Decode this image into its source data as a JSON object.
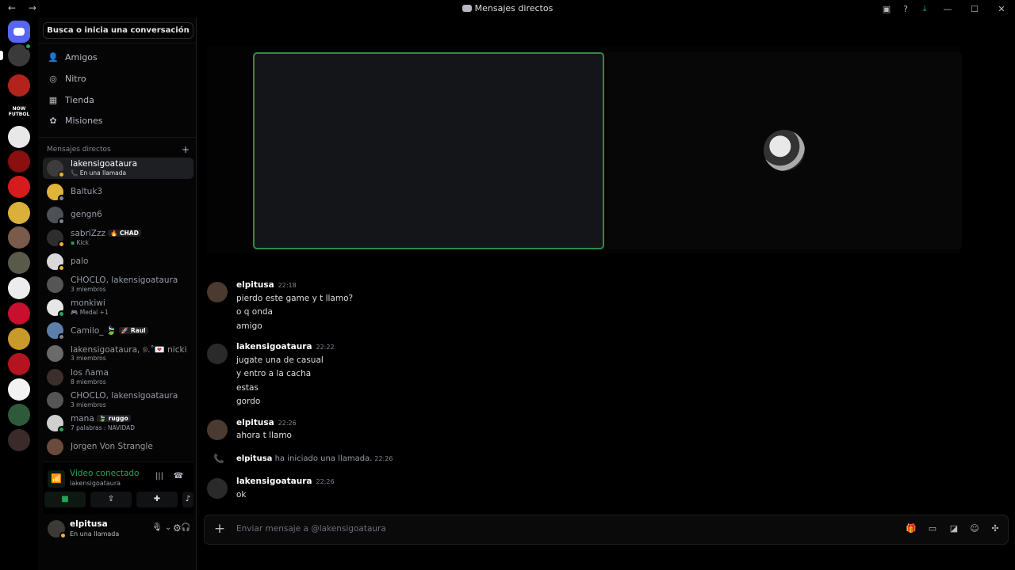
{
  "window": {
    "nav": "← →",
    "title": "Mensajes directos"
  },
  "servers": {
    "now_futbol_text": "NOW FUTBOL"
  },
  "sidebar": {
    "search_label": "Busca o inicia una conversación",
    "nav": [
      {
        "label": "Amigos",
        "icon": "friends-icon"
      },
      {
        "label": "Nitro",
        "icon": "nitro-icon"
      },
      {
        "label": "Tienda",
        "icon": "shop-icon"
      },
      {
        "label": "Misiones",
        "icon": "quests-icon"
      }
    ],
    "dm_header": "Mensajes directos",
    "dms": [
      {
        "name": "lakensigoataura",
        "sub": "En una llamada",
        "status": "idle"
      },
      {
        "name": "Baltuk3",
        "sub": "",
        "status": "offline"
      },
      {
        "name": "gengn6",
        "sub": "",
        "status": "offline"
      },
      {
        "name": "sabriZzz",
        "tag": "🔥 CHAD",
        "sub": "Kick",
        "status": "idle"
      },
      {
        "name": "palo",
        "sub": "",
        "status": "idle"
      },
      {
        "name": "CHOCLO, lakensigoataura",
        "sub": "3 miembros",
        "status": ""
      },
      {
        "name": "monkiwi",
        "sub": "Medal +1",
        "status": "online"
      },
      {
        "name": "Camilo_ 🍃",
        "tag": "🚀 Raul",
        "sub": "",
        "status": "offline"
      },
      {
        "name": "lakensigoataura, ୭.˚💌 nicki nic...",
        "sub": "3 miembros",
        "status": ""
      },
      {
        "name": "los ñama",
        "sub": "8 miembros",
        "status": ""
      },
      {
        "name": "CHOCLO, lakensigoataura",
        "sub": "3 miembros",
        "status": ""
      },
      {
        "name": "mana",
        "tag": "🍃 ruggo",
        "sub": "7 palabras : NAVIDAD",
        "status": "online"
      },
      {
        "name": "Jorgen Von Strangle",
        "sub": "",
        "status": ""
      }
    ]
  },
  "voice": {
    "title": "Video conectado",
    "channel": "lakensigoataura"
  },
  "user": {
    "name": "elpitusa",
    "status": "En una llamada"
  },
  "messages": [
    {
      "author": "elpitusa",
      "time": "22:18",
      "lines": [
        "pierdo este game y t llamo?",
        "o q onda",
        "amigo"
      ]
    },
    {
      "author": "lakensigoataura",
      "time": "22:22",
      "lines": [
        "jugate una de casual",
        "y entro a la cacha",
        "estas",
        "gordo"
      ]
    },
    {
      "author": "elpitusa",
      "time": "22:26",
      "lines": [
        "ahora t llamo"
      ]
    },
    {
      "author": "lakensigoataura",
      "time": "22:26",
      "lines": [
        "ok"
      ]
    }
  ],
  "system": {
    "user": "elpitusa",
    "text": "ha iniciado una llamada.",
    "time": "22:26"
  },
  "composer": {
    "placeholder": "Enviar mensaje a @lakensigoataura"
  },
  "colors": {
    "accent": "#5865f2",
    "online": "#23a55a",
    "idle": "#f0b232"
  }
}
